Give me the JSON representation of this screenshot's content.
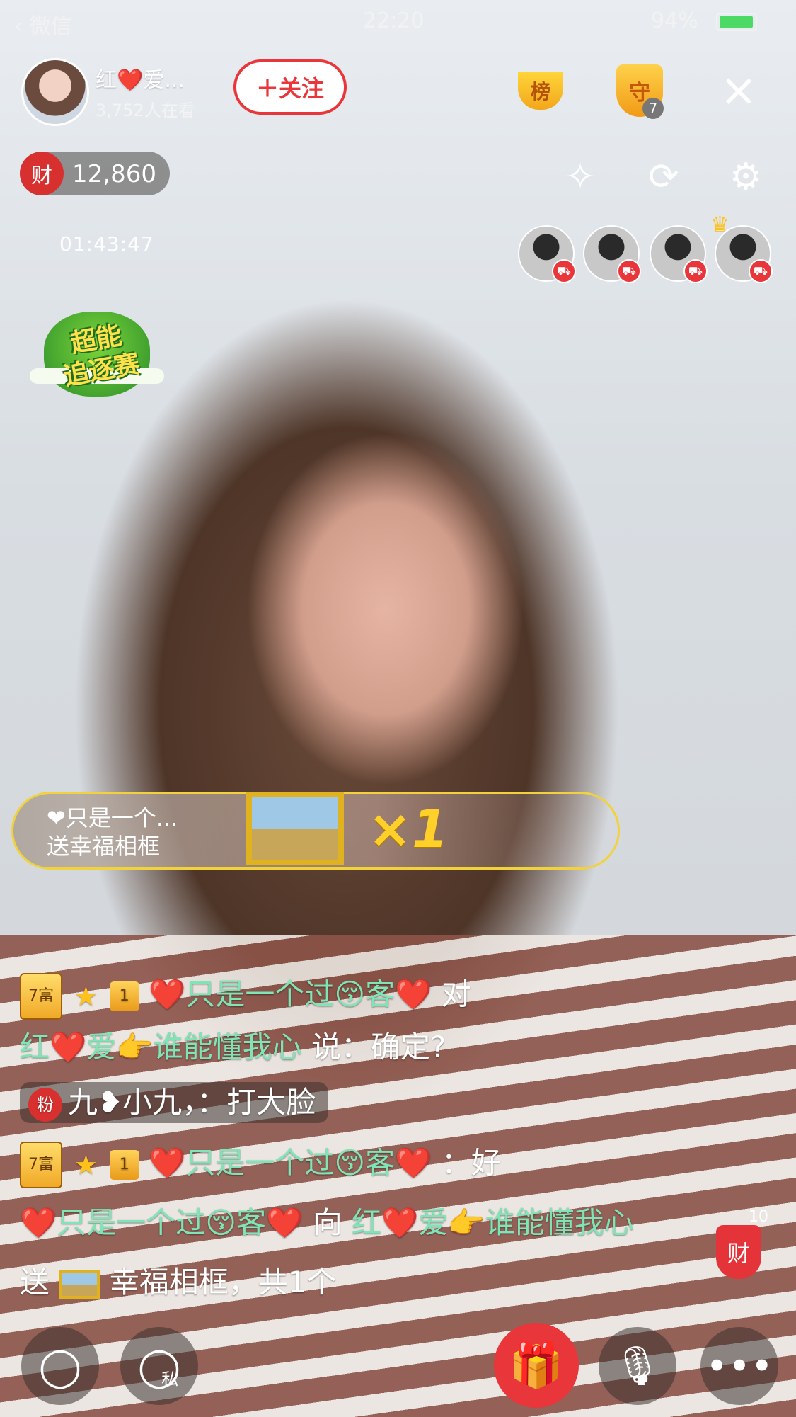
{
  "status_bar": {
    "back_app": "微信",
    "time": "22:20",
    "battery": "94%"
  },
  "streamer": {
    "name": "红❤️爱...",
    "viewers": "3,752人在看",
    "follow_label": "＋关注"
  },
  "top_badges": {
    "rank_label": "榜",
    "guard_label": "守",
    "guard_count": "7"
  },
  "wealth": {
    "icon_label": "财",
    "value": "12,860"
  },
  "timer": "01:43:47",
  "promo": {
    "line1": "超能",
    "line2": "追逐赛"
  },
  "gift_banner": {
    "sender": "❤只是一个...",
    "action": "送幸福相框",
    "count": "×1"
  },
  "chat": [
    {
      "level": "7富",
      "rank": "1",
      "user": "❤️只是一个过😚客❤️",
      "to": "对",
      "target": "红❤️爱👉谁能懂我心",
      "text": "说：确定?"
    },
    {
      "fan": "粉",
      "user": "九❥小九，",
      "text": "：打大脸"
    },
    {
      "level": "7富",
      "rank": "1",
      "user": "❤️只是一个过😚客❤️",
      "text": "：好"
    },
    {
      "user": "❤️只是一个过😚客❤️",
      "to": "向",
      "target": "红❤️爱👉谁能懂我心",
      "send": "送",
      "gift": "幸福相框，共1个"
    }
  ],
  "side": {
    "fortune_label": "财",
    "fortune_count": "10"
  },
  "bottom_bar": {
    "private_label": "私"
  },
  "icons": {
    "close": "close-icon",
    "beauty": "magic-wand-icon",
    "flip": "camera-flip-icon",
    "settings": "gear-icon",
    "chat": "chat-bubble-icon",
    "private": "private-chat-icon",
    "gift": "gift-icon",
    "mic": "mic-plus-icon",
    "more": "more-icon"
  },
  "colors": {
    "accent_red": "#e8363b",
    "gold": "#f2d23c",
    "chat_green": "#7fe4b6"
  }
}
